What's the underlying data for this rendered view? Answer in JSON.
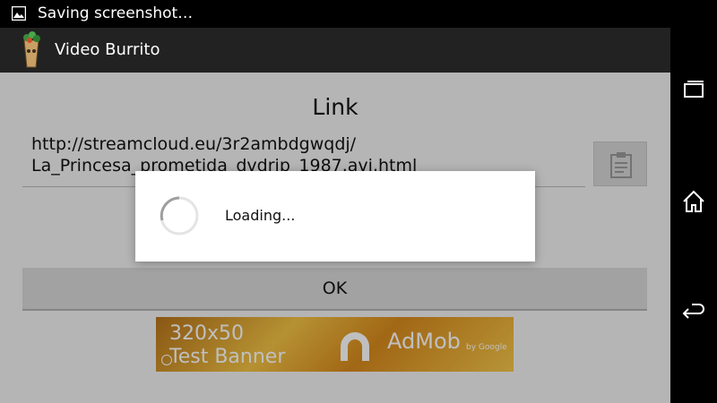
{
  "status_bar": {
    "text": "Saving screenshot…"
  },
  "action_bar": {
    "title": "Video Burrito"
  },
  "main": {
    "heading": "Link",
    "url_value": "http://streamcloud.eu/3r2ambdgwqdj/\nLa_Princesa_prometida_dvdrip_1987.avi.html",
    "ok_label": "OK"
  },
  "dialog": {
    "message": "Loading..."
  },
  "ad": {
    "line1": "320x50",
    "line2": "Test Banner",
    "brand": "AdMob",
    "by": "by Google"
  },
  "nav": {
    "icons": [
      "recents-icon",
      "home-icon",
      "back-icon"
    ]
  },
  "colors": {
    "status_bar": "#000000",
    "action_bar": "#222222",
    "content_bg": "#f2f2f2",
    "dialog_bg": "#ffffff"
  }
}
